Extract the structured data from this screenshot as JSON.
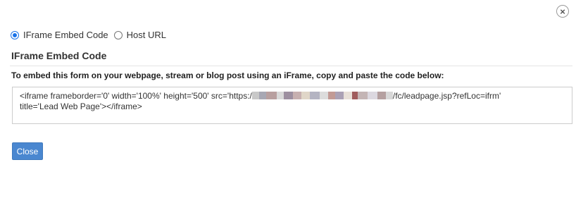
{
  "dialog": {
    "close_icon_glyph": "×",
    "radio_options": [
      {
        "label": "IFrame Embed Code",
        "checked": true
      },
      {
        "label": "Host URL",
        "checked": false
      }
    ],
    "section_title": "IFrame Embed Code",
    "instruction": "To embed this form on your webpage, stream or blog post using an iFrame, copy and paste the code below:",
    "code": {
      "prefix": "<iframe frameborder='0' width='100%' height='500' src='https:/",
      "suffix": "/fc/leadpage.jsp?refLoc=ifrm'",
      "line2": "title='Lead Web Page'></iframe>"
    },
    "close_button_label": "Close",
    "accent_color": "#4a87d0"
  }
}
